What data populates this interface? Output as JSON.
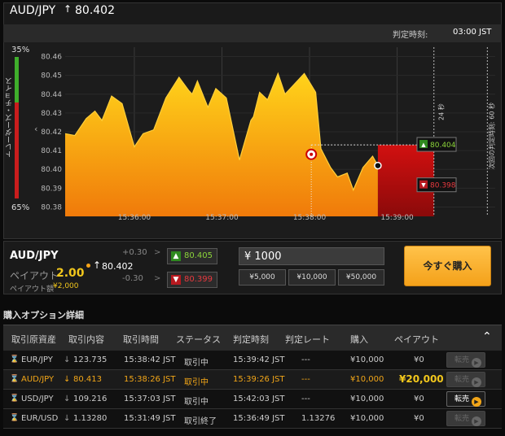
{
  "header": {
    "pair": "AUD/JPY",
    "rate_arrow": "↑",
    "rate": "80.402"
  },
  "expiry": {
    "label": "判定時刻:",
    "value": "03:00 JST"
  },
  "gauge": {
    "top_pct": "35%",
    "bottom_pct": "65%",
    "label": "トレーダーズ・チョイス",
    "chevron": "‹"
  },
  "chart_data": {
    "type": "area",
    "y_ticks": [
      "80.46",
      "80.45",
      "80.44",
      "80.43",
      "80.42",
      "80.41",
      "80.40",
      "80.39",
      "80.38"
    ],
    "ylim": [
      80.375,
      80.465
    ],
    "x_ticks": [
      "15:36:00",
      "15:37:00",
      "15:38:00",
      "15:39:00"
    ],
    "x_tick_minutes": [
      0,
      1,
      2,
      3
    ],
    "xlim_minutes": [
      -0.79,
      4.12
    ],
    "series_minutes": [
      -0.79,
      -0.68,
      -0.55,
      -0.45,
      -0.37,
      -0.26,
      -0.14,
      0.0,
      0.1,
      0.22,
      0.36,
      0.51,
      0.62,
      0.66,
      0.72,
      0.84,
      0.93,
      1.05,
      1.2,
      1.33,
      1.36,
      1.43,
      1.52,
      1.64,
      1.72,
      1.84,
      1.94,
      2.07,
      2.13,
      2.24,
      2.32,
      2.43,
      2.5,
      2.61,
      2.72,
      2.78
    ],
    "series_values": [
      80.419,
      80.418,
      80.427,
      80.431,
      80.426,
      80.439,
      80.435,
      80.412,
      80.419,
      80.421,
      80.438,
      80.449,
      80.442,
      80.44,
      80.447,
      80.433,
      80.443,
      80.438,
      80.405,
      80.426,
      80.428,
      80.441,
      80.437,
      80.451,
      80.44,
      80.446,
      80.451,
      80.441,
      80.411,
      80.401,
      80.396,
      80.398,
      80.389,
      80.401,
      80.407,
      80.402
    ],
    "marker_open": {
      "minute": 2.02,
      "value": 80.408
    },
    "marker_current": {
      "minute": 2.78,
      "value": 80.402
    },
    "strike_level": 80.413,
    "upper_label": "80.404",
    "lower_label": "80.398",
    "vertical_label_1": "24 秒",
    "vertical_label_2": "次回の判定時刻: 60 秒"
  },
  "trade": {
    "pair": "AUD/JPY",
    "payout_label": "ペイアウト",
    "payout_value": "2.00",
    "payout_amount_label": "ペイアウト額",
    "payout_amount": "¥2,000",
    "rate_arrow": "↑",
    "rate": "80.402",
    "plus": "+0.30",
    "minus": "-0.30",
    "gt": ">",
    "up_price": "80.405",
    "down_price": "80.399",
    "amount": "¥ 1000",
    "amount_buttons": [
      "¥5,000",
      "¥10,000",
      "¥50,000"
    ],
    "buy_label": "今すぐ購入"
  },
  "options": {
    "title": "購入オプション詳細",
    "columns": [
      "取引原資産",
      "取引内容",
      "取引時間",
      "ステータス",
      "判定時刻",
      "判定レート",
      "購入",
      "ペイアウト"
    ],
    "collapse_icon": "⌃",
    "rows": [
      {
        "asset": "EUR/JPY",
        "dir": "↓",
        "rate": "123.735",
        "time": "15:38:42 JST",
        "status": "取引中",
        "expiry": "15:39:42 JST",
        "exp_rate": "---",
        "buy": "¥10,000",
        "payout": "¥0",
        "sell": "転売"
      },
      {
        "asset": "AUD/JPY",
        "dir": "↓",
        "rate": "80.413",
        "time": "15:38:26 JST",
        "status": "取引中",
        "expiry": "15:39:26 JST",
        "exp_rate": "---",
        "buy": "¥10,000",
        "payout": "¥20,000",
        "sell": "転売"
      },
      {
        "asset": "USD/JPY",
        "dir": "↓",
        "rate": "109.216",
        "time": "15:37:03 JST",
        "status": "取引中",
        "expiry": "15:42:03 JST",
        "exp_rate": "---",
        "buy": "¥10,000",
        "payout": "¥0",
        "sell": "転売"
      },
      {
        "asset": "EUR/USD",
        "dir": "↓",
        "rate": "1.13280",
        "time": "15:31:49 JST",
        "status": "取引終了",
        "expiry": "15:36:49 JST",
        "exp_rate": "1.13276",
        "buy": "¥10,000",
        "payout": "¥0",
        "sell": "転売"
      }
    ]
  },
  "colors": {
    "up": "#8cd43a",
    "down": "#e8393f",
    "accent": "#f7a418",
    "gold": "#f2c71c"
  }
}
